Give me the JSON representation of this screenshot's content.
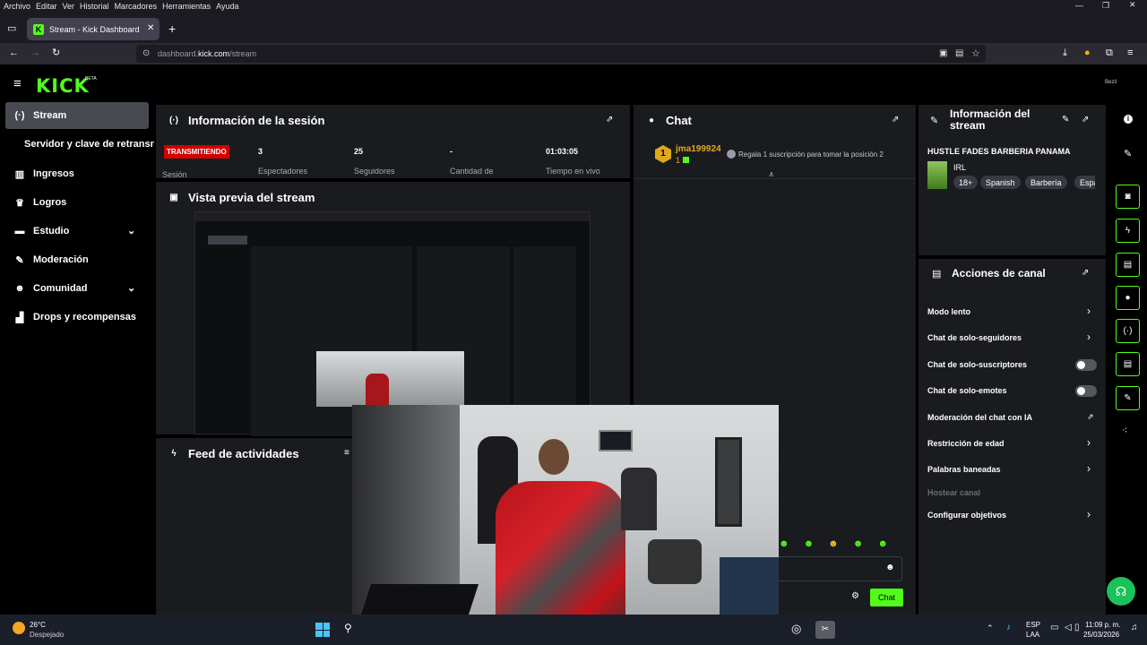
{
  "browser": {
    "menu": [
      "Archivo",
      "Editar",
      "Ver",
      "Historial",
      "Marcadores",
      "Herramientas",
      "Ayuda"
    ],
    "tab_title": "Stream - Kick Dashboard",
    "url_prefix": "dashboard.",
    "url_domain": "kick.com",
    "url_path": "/stream"
  },
  "app": {
    "logo": "KICK",
    "beta": "BETA",
    "user": "Bezil"
  },
  "sidebar": {
    "items": [
      {
        "label": "Stream",
        "icon": "broadcast-icon"
      },
      {
        "label": "Servidor y clave de retransn",
        "icon": ""
      },
      {
        "label": "Ingresos",
        "icon": "chart-icon"
      },
      {
        "label": "Logros",
        "icon": "trophy-icon"
      },
      {
        "label": "Estudio",
        "icon": "studio-icon"
      },
      {
        "label": "Moderación",
        "icon": "wrench-icon"
      },
      {
        "label": "Comunidad",
        "icon": "community-icon"
      },
      {
        "label": "Drops y recompensas",
        "icon": "drops-icon"
      }
    ]
  },
  "session": {
    "title": "Información de la sesión",
    "status": "TRANSMITIENDO",
    "status_label": "Sesión",
    "stats": [
      {
        "value": "3",
        "label": "Espectadores"
      },
      {
        "value": "25",
        "label": "Seguidores"
      },
      {
        "value": "-",
        "label": "Cantidad de"
      },
      {
        "value": "01:03:05",
        "label": "Tiempo en vivo"
      }
    ]
  },
  "preview": {
    "title": "Vista previa del stream"
  },
  "feed": {
    "title": "Feed de actividades"
  },
  "chat": {
    "title": "Chat",
    "top_user": "jma199924",
    "top_count": "1",
    "rank": "1",
    "gift_text": "Regala 1 suscripción para tomar la posición 2",
    "send_label": "Chat"
  },
  "stream_info": {
    "title": "Información del stream",
    "stream_title": "HUSTLE FADES BARBERIA PANAMA",
    "category": "IRL",
    "tags": [
      "18+",
      "Spanish",
      "Barbería",
      "Espa"
    ]
  },
  "actions": {
    "title": "Acciones de canal",
    "items": [
      {
        "label": "Modo lento",
        "control": "chevron"
      },
      {
        "label": "Chat de solo-seguidores",
        "control": "chevron"
      },
      {
        "label": "Chat de solo-suscriptores",
        "control": "toggle"
      },
      {
        "label": "Chat de solo-emotes",
        "control": "toggle"
      },
      {
        "label": "Moderación del chat con IA",
        "control": "external"
      },
      {
        "label": "Restricción de edad",
        "control": "chevron"
      },
      {
        "label": "Palabras baneadas",
        "control": "chevron"
      },
      {
        "label": "Hostear canal",
        "control": "disabled"
      },
      {
        "label": "Configurar objetivos",
        "control": "chevron"
      }
    ]
  },
  "taskbar": {
    "temp": "26°C",
    "weather": "Despejado",
    "lang1": "ESP",
    "lang2": "LAA",
    "time": "11:09 p. m.",
    "date": "25/03/2026"
  },
  "colors": {
    "accent": "#53fc18",
    "live": "#d10000",
    "panel": "#191b1f"
  }
}
